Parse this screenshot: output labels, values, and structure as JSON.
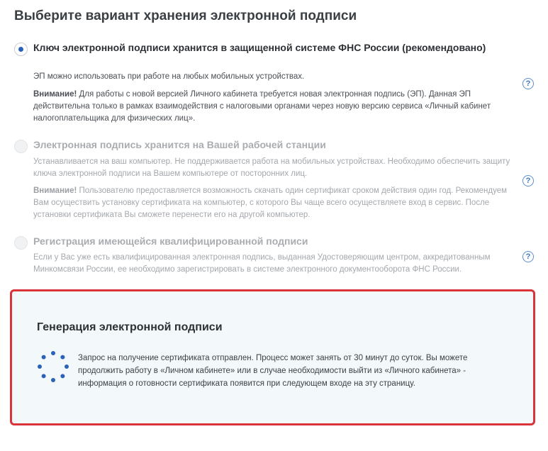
{
  "heading": "Выберите вариант хранения электронной подписи",
  "options": [
    {
      "title": "Ключ электронной подписи хранится в защищенной системе ФНС России (рекомендовано)",
      "text": "ЭП можно использовать при работе на любых мобильных устройствах.",
      "warning_label": "Внимание!",
      "warning_text": " Для работы с новой версией Личного кабинета требуется новая электронная подпись (ЭП). Данная ЭП действительна только в рамках взаимодействия с налоговыми органами через новую версию сервиса «Личный кабинет налогоплательщика для физических лиц».",
      "selected": true,
      "help": "?"
    },
    {
      "title": "Электронная подпись хранится на Вашей рабочей станции",
      "text": "Устанавливается на ваш компьютер. Не поддерживается работа на мобильных устройствах. Необходимо обеспечить защиту ключа электронной подписи на Вашем компьютере от посторонних лиц.",
      "warning_label": "Внимание!",
      "warning_text": " Пользователю предоставляется возможность скачать один сертификат  сроком действия один год. Рекомендуем Вам осуществить установку сертификата на компьютер, с которого Вы  чаще всего осуществляете вход в сервис. После установки сертификата Вы сможете перенести его на другой  компьютер.",
      "selected": false,
      "help": "?"
    },
    {
      "title": "Регистрация имеющейся квалифицированной подписи",
      "text": "Если у Вас уже есть квалифицированная электронная подпись, выданная Удостоверяющим центром, аккредитованным Минкомсвязи России, ее необходимо зарегистрировать в системе электронного документооборота ФНС России.",
      "selected": false,
      "help": "?"
    }
  ],
  "generation": {
    "title": "Генерация электронной подписи",
    "message": "Запрос на получение сертификата отправлен. Процесс может занять от 30 минут до суток. Вы можете продолжить работу в «Личном кабинете» или в случае необходимости выйти из «Личного кабинета» - информация о готовности сертификата появится при следующем входе на эту страницу."
  },
  "colors": {
    "accent": "#2a62b8",
    "highlight_border": "#d8343a",
    "panel_bg": "#f3f8fa"
  }
}
